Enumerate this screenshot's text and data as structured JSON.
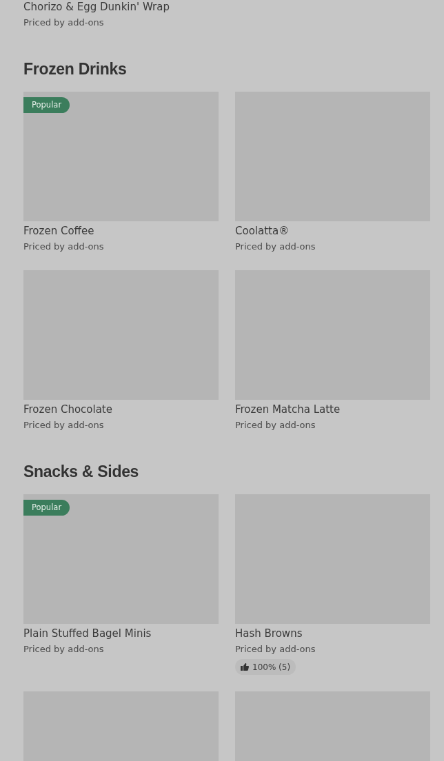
{
  "partial_item": {
    "name": "Chorizo & Egg Dunkin' Wrap",
    "price": "Priced by add-ons"
  },
  "sections": [
    {
      "title": "Frozen Drinks",
      "items": [
        {
          "kind": "product",
          "name": "Frozen Coffee",
          "price": "Priced by add-ons",
          "badge": "Popular"
        },
        {
          "kind": "product",
          "name": "Coolatta®",
          "price": "Priced by add-ons"
        },
        {
          "kind": "product",
          "name": "Frozen Chocolate",
          "price": "Priced by add-ons"
        },
        {
          "kind": "product",
          "name": "Frozen Matcha Latte",
          "price": "Priced by add-ons"
        }
      ]
    },
    {
      "title": "Snacks & Sides",
      "items": [
        {
          "kind": "product",
          "name": "Plain Stuffed Bagel Minis",
          "price": "Priced by add-ons",
          "badge": "Popular"
        },
        {
          "kind": "product",
          "name": "Hash Browns",
          "price": "Priced by add-ons",
          "rating": "100% (5)"
        },
        {
          "kind": "picture"
        },
        {
          "kind": "picture"
        }
      ]
    }
  ]
}
